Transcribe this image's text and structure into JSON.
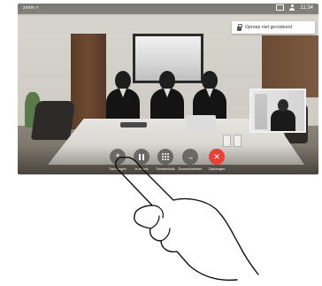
{
  "status_bar": {
    "left_text": "zoom >",
    "time": "11:34",
    "icons": [
      "screen-icon",
      "user-icon"
    ]
  },
  "banner": {
    "text": "Oproep niet gecodeerd",
    "icon": "lock-icon"
  },
  "controls": [
    {
      "id": "add",
      "icon": "plus-icon",
      "label": "Toevoegen"
    },
    {
      "id": "hold",
      "icon": "pause-icon",
      "label": "In wacht"
    },
    {
      "id": "keypad",
      "icon": "keypad-icon",
      "label": "Toetsenblok"
    },
    {
      "id": "transfer",
      "icon": "arrow-right-icon",
      "label": "Doorschakelen"
    },
    {
      "id": "end",
      "icon": "end-call-icon",
      "label": "Ophangen"
    }
  ],
  "colors": {
    "end_call": "#e8413a",
    "control_bg": "#5a5a5a"
  }
}
